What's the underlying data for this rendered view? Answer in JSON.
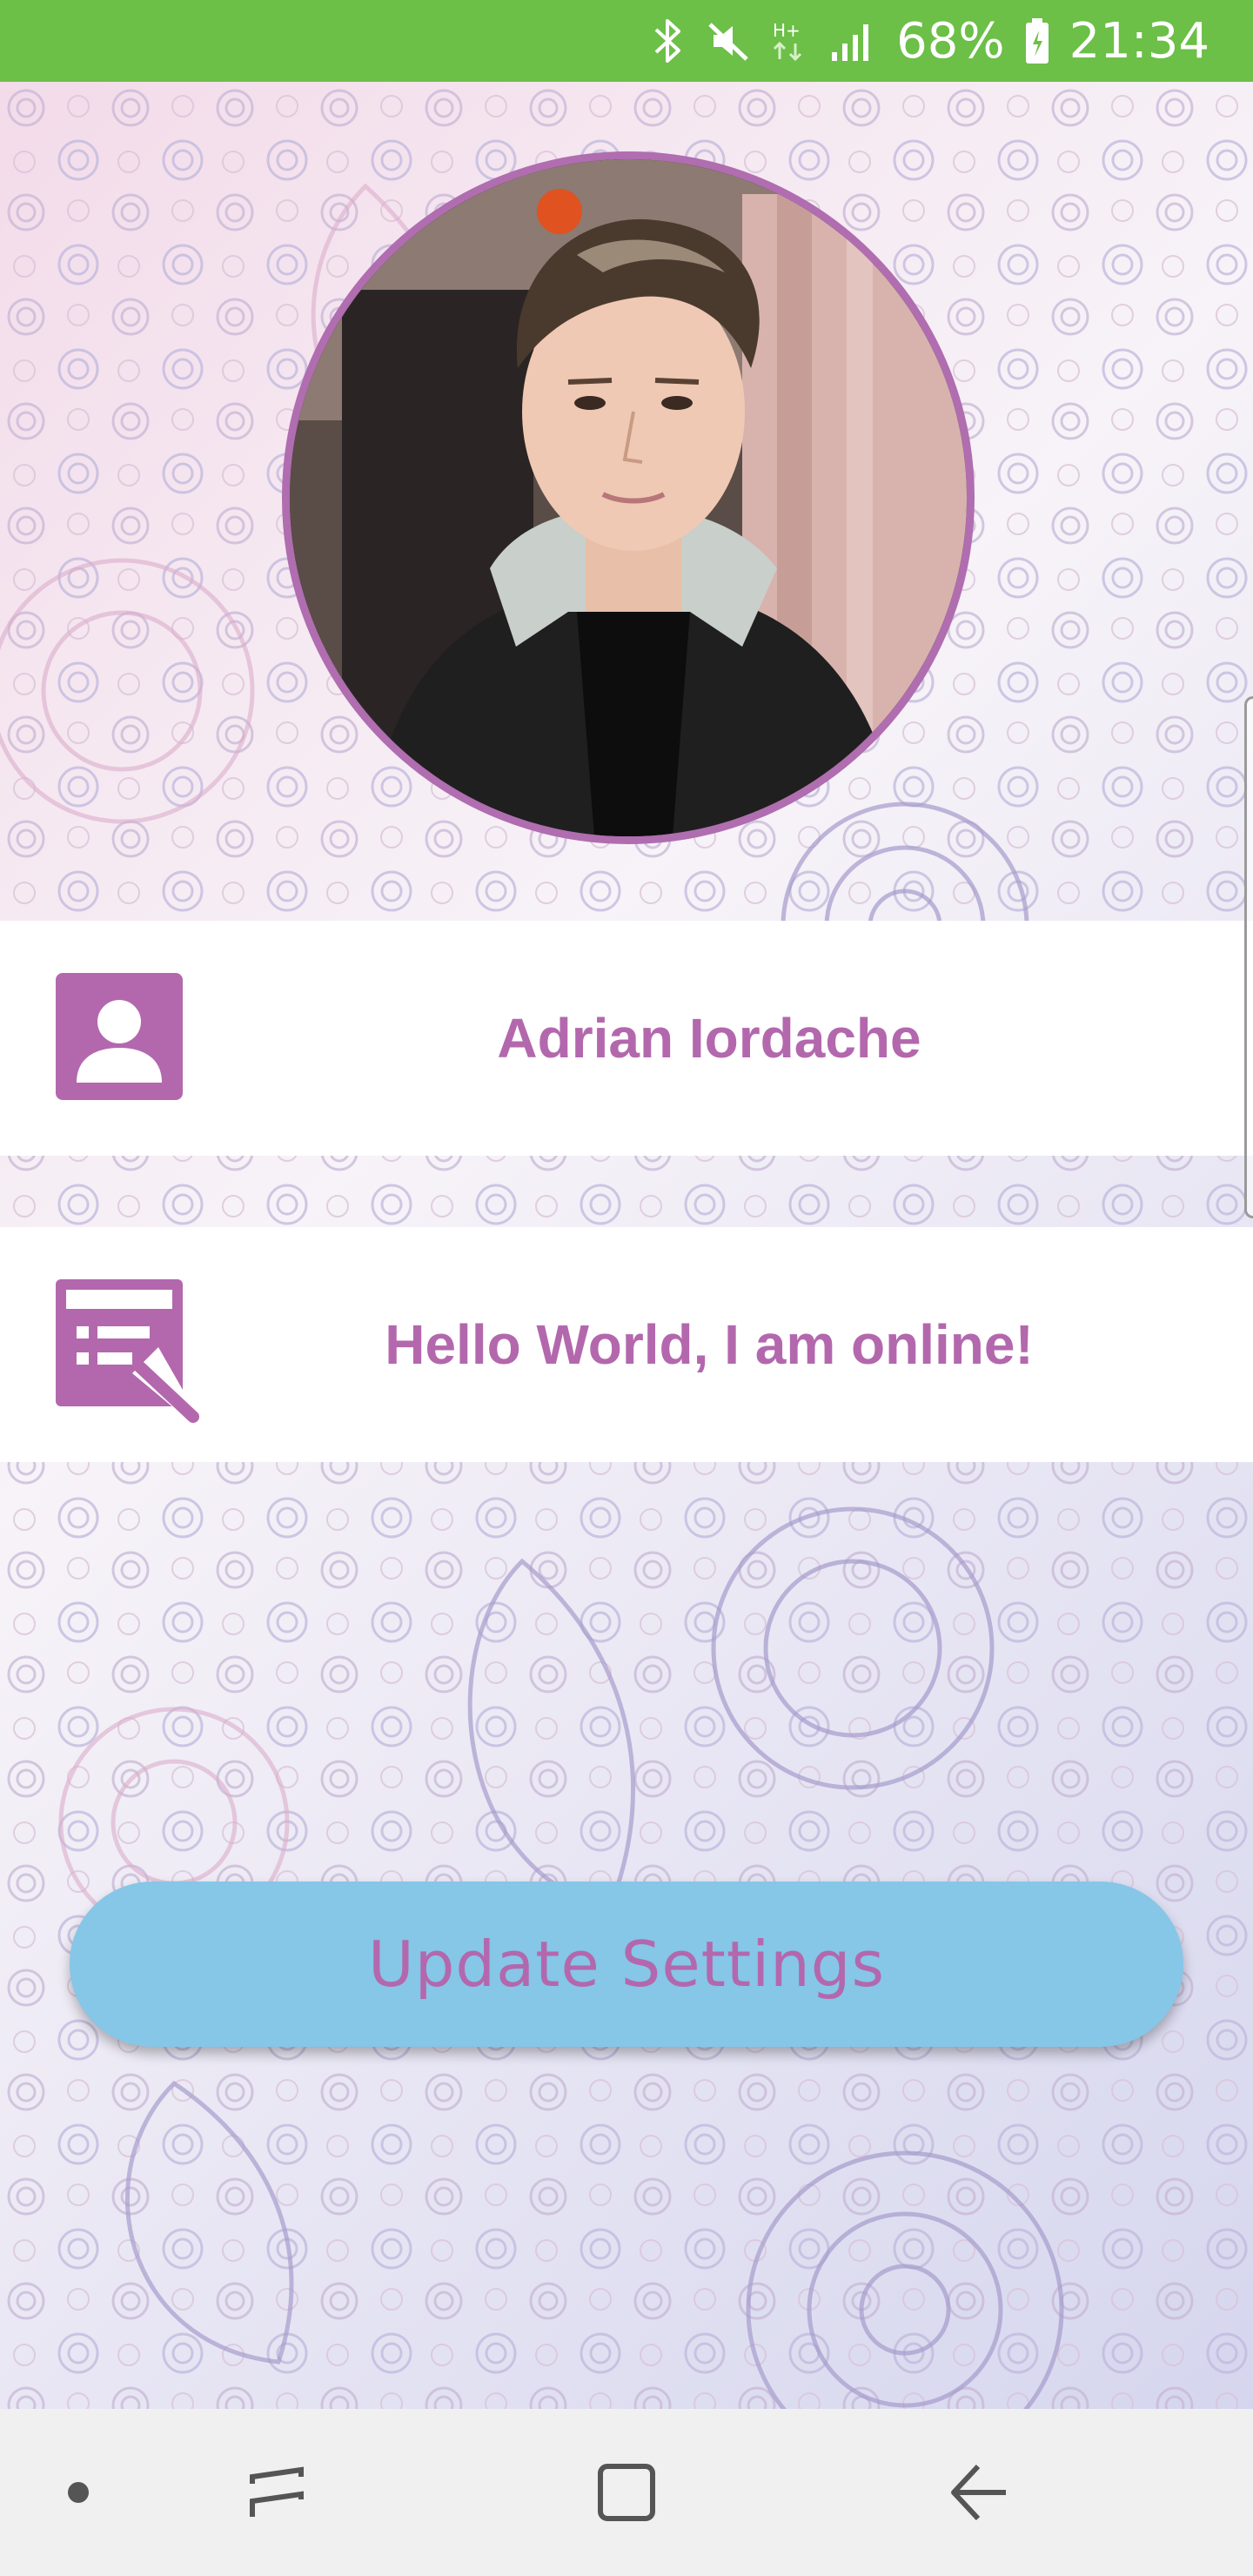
{
  "status_bar": {
    "battery_percent": "68%",
    "time": "21:34",
    "network_type": "H+",
    "icons": [
      "bluetooth-icon",
      "mute-icon",
      "network-type-icon",
      "signal-icon",
      "battery-icon"
    ],
    "background_color": "#6cbf47"
  },
  "profile": {
    "avatar_alt": "profile photo",
    "name": "Adrian Iordache",
    "status_message": "Hello World, I am online!",
    "name_icon": "contact-card-icon",
    "status_icon": "edit-status-icon",
    "accent_color": "#b368ad",
    "avatar_border_color": "#b06db0"
  },
  "actions": {
    "update_label": "Update Settings",
    "button_color": "#86c6e7"
  },
  "nav_bar": {
    "icons": [
      "dot-icon",
      "recent-apps-icon",
      "home-icon",
      "back-icon"
    ]
  }
}
